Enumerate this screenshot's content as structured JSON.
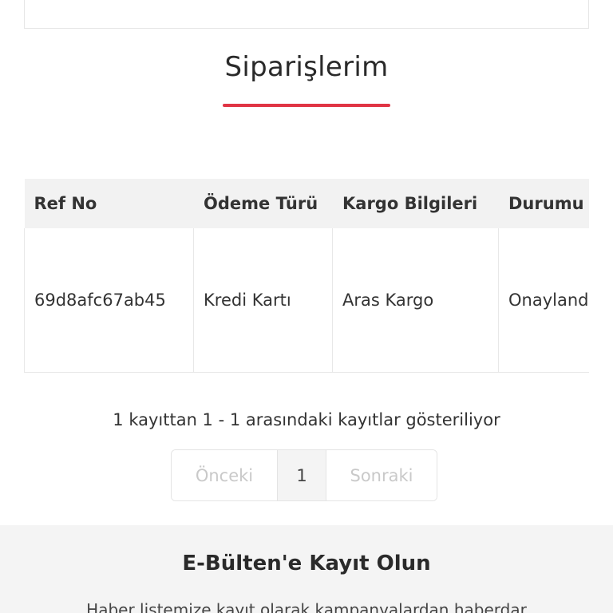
{
  "page": {
    "title": "Siparişlerim"
  },
  "orders_table": {
    "headers": [
      "Ref No",
      "Ödeme Türü",
      "Kargo Bilgileri",
      "Durumu"
    ],
    "rows": [
      [
        "69d8afc67ab45",
        "Kredi Kartı",
        "Aras Kargo",
        "Onaylandı"
      ]
    ]
  },
  "records_info": "1 kayıttan 1 - 1 arasındaki kayıtlar gösteriliyor",
  "pagination": {
    "prev_label": "Önceki",
    "current_page": "1",
    "next_label": "Sonraki"
  },
  "newsletter": {
    "title": "E-Bülten'e Kayıt Olun",
    "description": "Haber listemize kayıt olarak kampanyalardan haberdar"
  },
  "colors": {
    "accent": "#e03444"
  }
}
